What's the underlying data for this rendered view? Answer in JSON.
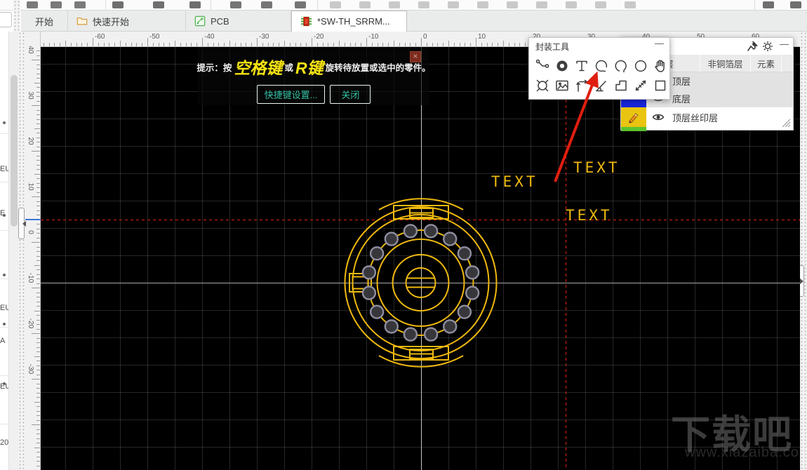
{
  "tab_bar": {
    "tabs": [
      {
        "label": "开始",
        "icon": null,
        "active": false
      },
      {
        "label": "快速开始",
        "icon": "folder-icon",
        "active": false
      },
      {
        "label": "PCB",
        "icon": "pcb-file-icon",
        "active": false
      },
      {
        "label": "*SW-TH_SRRM...",
        "icon": "footprint-chip-icon",
        "active": true
      }
    ]
  },
  "hint_bar": {
    "prefix": "提示：按",
    "key_space": "空格键",
    "conjunction": "或",
    "key_r": "R键",
    "suffix": "旋转待放置或选中的零件。",
    "shortcut_button": "快捷键设置...",
    "close_button": "关闭",
    "close_icon": "×"
  },
  "tools_panel": {
    "title": "封装工具",
    "minimize": "—",
    "tools": [
      "track-icon",
      "pad-icon",
      "text-icon",
      "arc-icon",
      "center-arc-icon",
      "circle-icon",
      "hand-drag-icon",
      "cutout-region-icon",
      "image-icon",
      "dimension-icon",
      "angle-icon",
      "solid-region-icon",
      "measure-icon",
      "rect-icon"
    ]
  },
  "layers_panel": {
    "header_icons": [
      "pin-icon",
      "gear-icon"
    ],
    "minimize": "—",
    "tabs": [
      "铜箔层",
      "非铜箔层",
      "元素"
    ],
    "layers": [
      {
        "label": "顶层",
        "swatch": null,
        "visible": true,
        "active": false
      },
      {
        "label": "底层",
        "swatch": "#1726df",
        "visible": true,
        "active": false
      },
      {
        "label": "顶层丝印层",
        "swatch": "#e9c410",
        "visible": true,
        "active": true
      }
    ],
    "next_layer_swatch": "#5cc32e"
  },
  "rulers": {
    "top_labels": [
      -60,
      -50,
      -40,
      -30,
      -20,
      -10,
      0,
      10,
      20,
      30,
      40,
      50,
      60
    ],
    "left_labels": [
      40,
      30,
      20,
      10,
      0,
      -10,
      -20,
      -30
    ]
  },
  "canvas": {
    "silk_texts": [
      "TEXT",
      "TEXT",
      "TEXT"
    ],
    "watermark_title": "下载吧",
    "watermark_url": "www.xiazaiba.com",
    "footprint": {
      "pad_count": 16
    }
  },
  "left_list": {
    "fragments": [
      "EU",
      "E",
      "EU",
      "A",
      "EU",
      "20"
    ]
  },
  "colors": {
    "silk_yellow": "#efb90f",
    "pad_fill": "#37373b",
    "pad_ring": "#8e8ea0",
    "crosshair_red": "#de2410",
    "arrow_red": "#e01e0f",
    "axis_white": "#c6c6c6",
    "accent_teal": "#35bfa4",
    "key_yellow": "#f5e312"
  }
}
